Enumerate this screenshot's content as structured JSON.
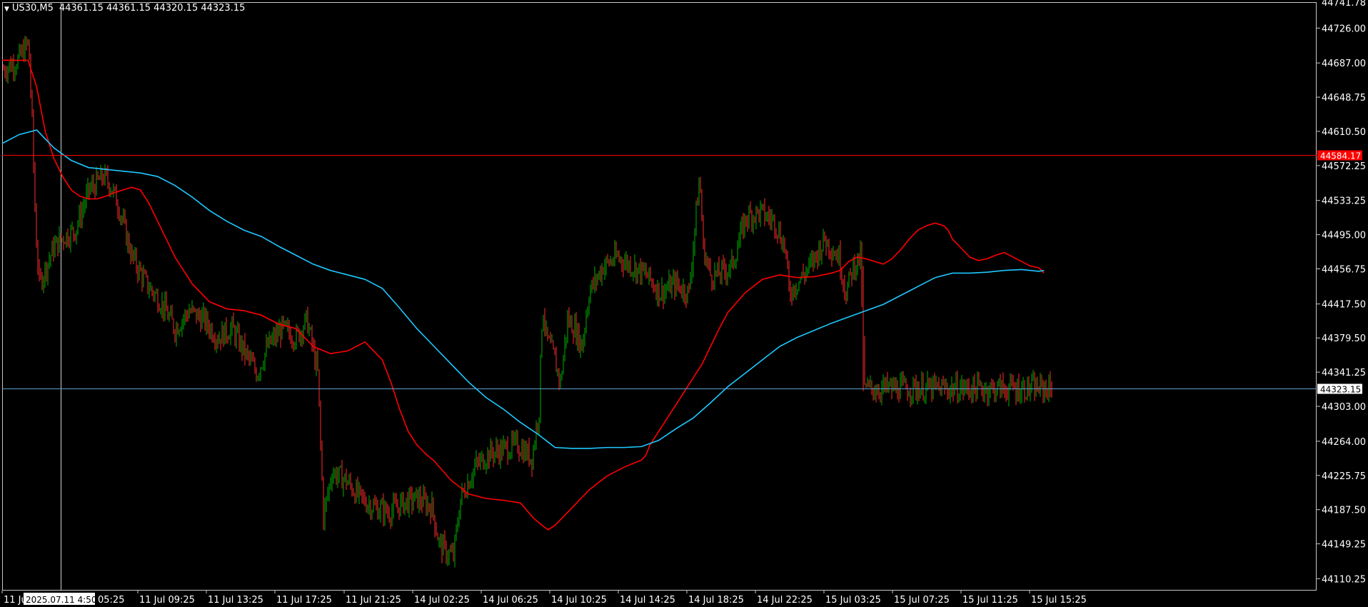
{
  "header": {
    "symbol": "US30,M5",
    "ohlc": "44361.15 44361.15 44320.15 44323.15"
  },
  "chart_data": {
    "type": "candlestick",
    "symbol": "US30",
    "timeframe": "M5",
    "ylim": [
      44097,
      44755
    ],
    "y_ticks": [
      "44726.00",
      "44687.00",
      "44648.75",
      "44610.50",
      "44572.25",
      "44533.25",
      "44495.00",
      "44456.75",
      "44417.50",
      "44379.50",
      "44341.25",
      "44303.00",
      "44264.00",
      "44225.75",
      "44187.50",
      "44149.25",
      "44110.25"
    ],
    "y_ticks_values": [
      44726.0,
      44687.0,
      44648.75,
      44610.5,
      44572.25,
      44533.25,
      44495.0,
      44456.75,
      44417.5,
      44379.5,
      44341.25,
      44303.0,
      44264.0,
      44225.75,
      44187.5,
      44149.25,
      44110.25
    ],
    "top_label": "44741.78",
    "x_ticks": [
      "11 Jul",
      "05:25",
      "11 Jul 09:25",
      "11 Jul 13:25",
      "11 Jul 17:25",
      "11 Jul 21:25",
      "14 Jul 02:25",
      "14 Jul 06:25",
      "14 Jul 10:25",
      "14 Jul 14:25",
      "14 Jul 18:25",
      "14 Jul 22:25",
      "15 Jul 03:25",
      "15 Jul 07:25",
      "15 Jul 11:25",
      "15 Jul 15:25"
    ],
    "crosshair_time": "2025.07.11 4:50",
    "levels": [
      {
        "name": "alert-level",
        "value": 44584.17,
        "label": "44584.17",
        "color": "#ff0000"
      },
      {
        "name": "current-bid",
        "value": 44323.15,
        "label": "44323.15",
        "color": "#5fa0d0"
      }
    ],
    "close_path": [
      [
        0,
        44680
      ],
      [
        20,
        44690
      ],
      [
        35,
        44710
      ],
      [
        40,
        44620
      ],
      [
        45,
        44500
      ],
      [
        50,
        44440
      ],
      [
        60,
        44460
      ],
      [
        70,
        44480
      ],
      [
        80,
        44490
      ],
      [
        100,
        44500
      ],
      [
        120,
        44545
      ],
      [
        140,
        44560
      ],
      [
        150,
        44550
      ],
      [
        160,
        44530
      ],
      [
        180,
        44470
      ],
      [
        200,
        44440
      ],
      [
        220,
        44420
      ],
      [
        240,
        44390
      ],
      [
        260,
        44410
      ],
      [
        280,
        44400
      ],
      [
        300,
        44380
      ],
      [
        320,
        44390
      ],
      [
        340,
        44360
      ],
      [
        355,
        44340
      ],
      [
        370,
        44370
      ],
      [
        390,
        44390
      ],
      [
        410,
        44380
      ],
      [
        425,
        44400
      ],
      [
        440,
        44340
      ],
      [
        448,
        44180
      ],
      [
        460,
        44230
      ],
      [
        480,
        44220
      ],
      [
        500,
        44200
      ],
      [
        520,
        44190
      ],
      [
        540,
        44185
      ],
      [
        560,
        44195
      ],
      [
        580,
        44200
      ],
      [
        600,
        44190
      ],
      [
        610,
        44150
      ],
      [
        620,
        44140
      ],
      [
        630,
        44135
      ],
      [
        640,
        44200
      ],
      [
        660,
        44235
      ],
      [
        680,
        44250
      ],
      [
        700,
        44255
      ],
      [
        720,
        44260
      ],
      [
        740,
        44245
      ],
      [
        750,
        44300
      ],
      [
        755,
        44420
      ],
      [
        760,
        44380
      ],
      [
        770,
        44360
      ],
      [
        780,
        44330
      ],
      [
        790,
        44400
      ],
      [
        800,
        44390
      ],
      [
        810,
        44370
      ],
      [
        820,
        44430
      ],
      [
        840,
        44460
      ],
      [
        860,
        44470
      ],
      [
        880,
        44460
      ],
      [
        900,
        44450
      ],
      [
        920,
        44430
      ],
      [
        940,
        44440
      ],
      [
        960,
        44430
      ],
      [
        970,
        44520
      ],
      [
        975,
        44560
      ],
      [
        980,
        44480
      ],
      [
        990,
        44450
      ],
      [
        1000,
        44450
      ],
      [
        1020,
        44460
      ],
      [
        1040,
        44515
      ],
      [
        1060,
        44520
      ],
      [
        1080,
        44510
      ],
      [
        1095,
        44480
      ],
      [
        1100,
        44430
      ],
      [
        1110,
        44440
      ],
      [
        1130,
        44460
      ],
      [
        1150,
        44490
      ],
      [
        1170,
        44470
      ],
      [
        1180,
        44430
      ],
      [
        1190,
        44460
      ],
      [
        1200,
        44470
      ],
      [
        1206,
        44323
      ]
    ],
    "series": [
      {
        "name": "MA-red",
        "color": "#ff0000",
        "x": [
          0,
          30,
          40,
          50,
          60,
          70,
          80,
          90,
          100,
          110,
          120,
          130,
          140,
          150,
          160,
          170,
          180,
          200,
          220,
          240,
          260,
          280,
          300,
          320,
          340,
          360,
          380,
          400,
          420,
          440,
          450,
          460,
          470,
          480,
          490,
          500,
          520,
          540,
          560,
          580,
          600,
          615,
          625,
          632,
          640,
          650,
          660,
          680,
          700,
          720,
          740,
          745,
          750,
          760,
          770,
          780,
          790,
          800,
          810,
          820,
          830,
          840,
          860,
          880,
          900,
          920,
          940,
          960,
          970,
          980,
          990,
          1000,
          1010,
          1020,
          1030,
          1040,
          1050,
          1060,
          1070,
          1080,
          1090,
          1095,
          1100,
          1110,
          1120,
          1130,
          1140,
          1150,
          1160,
          1170,
          1180,
          1190,
          1200,
          1206
        ],
        "y": [
          44690,
          44690,
          44660,
          44610,
          44580,
          44560,
          44545,
          44538,
          44535,
          44535,
          44538,
          44542,
          44545,
          44548,
          44545,
          44530,
          44510,
          44470,
          44440,
          44420,
          44412,
          44410,
          44405,
          44395,
          44390,
          44370,
          44362,
          44365,
          44375,
          44355,
          44330,
          44300,
          44275,
          44260,
          44250,
          44242,
          44220,
          44205,
          44200,
          44198,
          44195,
          44178,
          44170,
          44165,
          44170,
          44180,
          44190,
          44210,
          44225,
          44235,
          44243,
          44248,
          44260,
          44275,
          44290,
          44305,
          44320,
          44335,
          44350,
          44370,
          44390,
          44408,
          44430,
          44445,
          44450,
          44447,
          44448,
          44452,
          44455,
          44465,
          44470,
          44468,
          44465,
          44462,
          44468,
          44478,
          44490,
          44500,
          44505,
          44508,
          44505,
          44500,
          44490,
          44480,
          44470,
          44466,
          44468,
          44472,
          44475,
          44470,
          44465,
          44460,
          44458,
          44452
        ]
      },
      {
        "name": "MA-blue",
        "color": "#1ec8ff",
        "x": [
          0,
          20,
          40,
          60,
          80,
          100,
          120,
          140,
          160,
          180,
          200,
          220,
          240,
          260,
          280,
          300,
          320,
          340,
          360,
          380,
          400,
          420,
          440,
          460,
          480,
          500,
          520,
          540,
          560,
          580,
          600,
          620,
          640,
          660,
          680,
          700,
          720,
          740,
          760,
          780,
          800,
          820,
          840,
          860,
          880,
          900,
          920,
          940,
          960,
          980,
          1000,
          1020,
          1040,
          1060,
          1080,
          1100,
          1120,
          1140,
          1160,
          1180,
          1200,
          1206
        ],
        "y": [
          44597,
          44607,
          44612,
          44592,
          44578,
          44570,
          44568,
          44566,
          44564,
          44560,
          44550,
          44537,
          44522,
          44510,
          44500,
          44493,
          44482,
          44472,
          44462,
          44455,
          44450,
          44445,
          44435,
          44413,
          44390,
          44370,
          44350,
          44330,
          44313,
          44300,
          44285,
          44272,
          44257,
          44256,
          44256,
          44257,
          44257,
          44258,
          44265,
          44278,
          44290,
          44307,
          44325,
          44340,
          44355,
          44370,
          44380,
          44388,
          44396,
          44403,
          44410,
          44417,
          44427,
          44437,
          44447,
          44452,
          44452,
          44453,
          44455,
          44456,
          44454,
          44455
        ]
      }
    ]
  }
}
